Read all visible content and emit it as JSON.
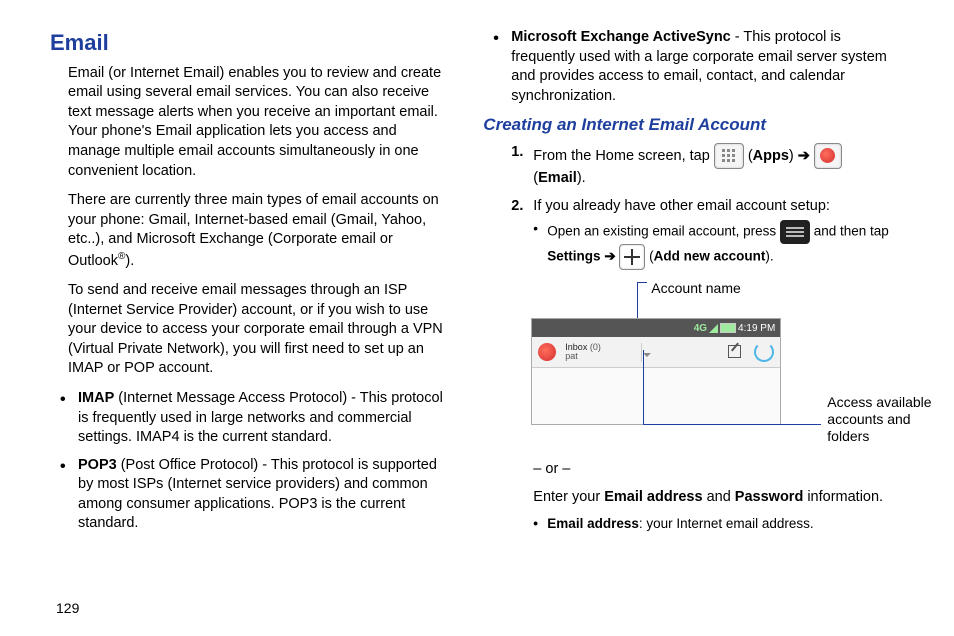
{
  "page_number": "129",
  "left": {
    "title": "Email",
    "p1": "Email (or Internet Email) enables you to review and create email using several email services. You can also receive text message alerts when you receive an important email. Your phone's Email application lets you access and manage multiple email accounts simultaneously in one convenient location.",
    "p2a": "There are currently three main types of email accounts on your phone: Gmail, Internet-based email (Gmail, Yahoo, etc..), and Microsoft Exchange (Corporate email or Outlook",
    "p2b": ").",
    "p3": "To send and receive email messages through an ISP (Internet Service Provider) account, or if you wish to use your device to access your corporate email through a VPN (Virtual Private Network), you will first need to set up an IMAP or POP account.",
    "bullets": [
      {
        "term": "IMAP",
        "text": " (Internet Message Access Protocol) - This protocol is frequently used in large networks and commercial settings. IMAP4 is the current standard."
      },
      {
        "term": "POP3",
        "text": " (Post Office Protocol) - This protocol is supported by most ISPs (Internet service providers) and common among consumer applications. POP3 is the current standard."
      }
    ]
  },
  "right": {
    "top_bullet": {
      "term": "Microsoft Exchange ActiveSync",
      "text": " - This protocol is frequently used with a large corporate email server system and provides access to email, contact, and calendar synchronization."
    },
    "subhead": "Creating an Internet Email Account",
    "step1_a": "From the Home screen, tap ",
    "step1_apps": "Apps",
    "step1_b": " ➔ ",
    "step1_email": "Email",
    "step2": "If you already have other email account setup:",
    "sub_open_a": "Open an existing email account, press ",
    "sub_open_b": " and then tap ",
    "settings": "Settings",
    "arrow": " ➔ ",
    "add_new": "Add new account",
    "callout_top": "Account name",
    "callout_right_l1": "Access available",
    "callout_right_l2": "accounts and",
    "callout_right_l3": "folders",
    "mock": {
      "time": "4:19 PM",
      "net": "4G",
      "inbox": "Inbox",
      "count": "(0)",
      "acct": "pat"
    },
    "or": "– or –",
    "enter_a": "Enter your ",
    "enter_b": "Email address",
    "enter_c": " and ",
    "enter_d": "Password",
    "enter_e": " information.",
    "bullet_email_a": "Email address",
    "bullet_email_b": ": your Internet email address."
  }
}
